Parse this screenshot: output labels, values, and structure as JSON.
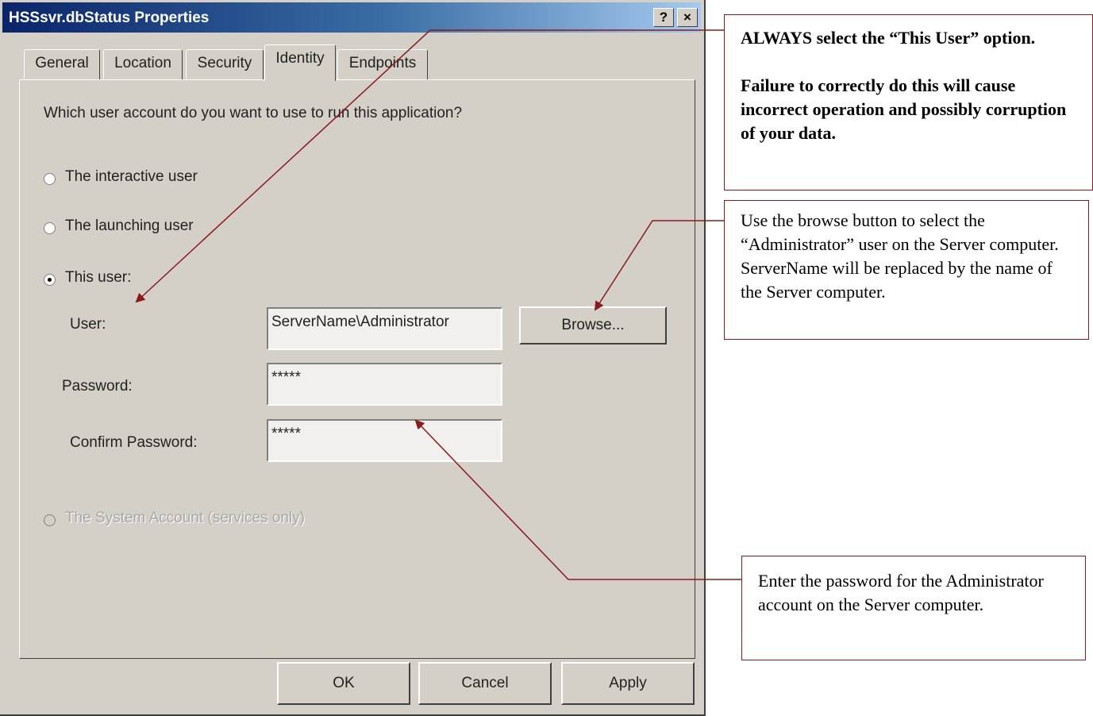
{
  "window": {
    "title": "HSSsvr.dbStatus Properties",
    "help_label": "?",
    "close_label": "×"
  },
  "tabs": [
    {
      "label": "General",
      "active": false
    },
    {
      "label": "Location",
      "active": false
    },
    {
      "label": "Security",
      "active": false
    },
    {
      "label": "Identity",
      "active": true
    },
    {
      "label": "Endpoints",
      "active": false
    }
  ],
  "identity": {
    "question": "Which user account do you want to use to run this application?",
    "options": [
      {
        "label": "The interactive user",
        "selected": false,
        "enabled": true
      },
      {
        "label": "The launching user",
        "selected": false,
        "enabled": true
      },
      {
        "label": "This user:",
        "selected": true,
        "enabled": true
      },
      {
        "label": "The System Account (services only)",
        "selected": false,
        "enabled": false
      }
    ],
    "user_label": "User:",
    "user_value": "ServerName\\Administrator",
    "browse_label": "Browse...",
    "password_label": "Password:",
    "password_value": "*****",
    "confirm_label": "Confirm Password:",
    "confirm_value": "*****"
  },
  "buttons": {
    "ok": "OK",
    "cancel": "Cancel",
    "apply": "Apply"
  },
  "callouts": {
    "always": {
      "line1": "ALWAYS select the “This User” option.",
      "line2": "Failure to correctly do this will cause incorrect operation and possibly corruption of your data."
    },
    "browse": "Use the browse button to select the “Administrator” user on the Server computer.  ServerName will be replaced by the name of the Server computer.",
    "password": "Enter the password for the Administrator account on the Server computer."
  },
  "colors": {
    "dialog_face": "#d4d0c8",
    "title_gradient_start": "#0a246a",
    "callout_border": "#8b1a1a",
    "arrow": "#8b1a1a"
  }
}
